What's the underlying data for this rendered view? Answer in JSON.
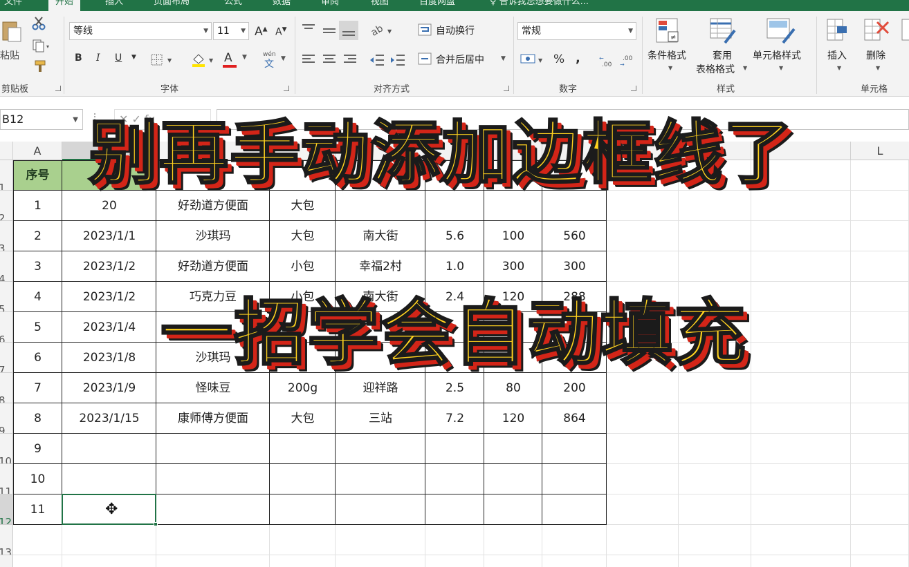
{
  "ribbon_tabs": [
    "文件",
    "开始",
    "插入",
    "页面布局",
    "公式",
    "数据",
    "审阅",
    "视图",
    "百度网盘",
    "告诉我您想要做什么..."
  ],
  "clipboard": {
    "paste_label": "粘贴",
    "group_label": "剪贴板"
  },
  "font": {
    "name": "等线",
    "size": "11",
    "bold": "B",
    "italic": "I",
    "underline": "U",
    "group_label": "字体",
    "grow": "A",
    "shrink": "A",
    "font_color_glyph": "A",
    "phonetic": "wén"
  },
  "alignment": {
    "wrap_label": "自动换行",
    "merge_label": "合并后居中",
    "group_label": "对齐方式"
  },
  "number": {
    "format": "常规",
    "percent": "%",
    "comma": ",",
    "group_label": "数字"
  },
  "styles": {
    "conditional_label": "条件格式",
    "table_format_label_1": "套用",
    "table_format_label_2": "表格格式",
    "cell_style_label": "单元格样式",
    "group_label": "样式"
  },
  "cells_group": {
    "insert_label": "插入",
    "delete_label": "删除",
    "group_label": "单元格"
  },
  "formula_bar": {
    "name_box": "B12",
    "fx_glyphs": "✕  ✓  fx"
  },
  "columns": [
    "A",
    "",
    "",
    "",
    "",
    "",
    "",
    "",
    "",
    "",
    "",
    "L"
  ],
  "rows": [
    "1",
    "2",
    "3",
    "4",
    "5",
    "6",
    "7",
    "8",
    "9",
    "10",
    "11",
    "12",
    "13"
  ],
  "table": {
    "headers": [
      "序号",
      "进"
    ],
    "rows": [
      [
        "1",
        "20",
        "好劲道方便面",
        "大包",
        "",
        "",
        "",
        ""
      ],
      [
        "2",
        "2023/1/1",
        "沙琪玛",
        "大包",
        "南大街",
        "5.6",
        "100",
        "560"
      ],
      [
        "3",
        "2023/1/2",
        "好劲道方便面",
        "小包",
        "幸福2村",
        "1.0",
        "300",
        "300"
      ],
      [
        "4",
        "2023/1/2",
        "巧克力豆",
        "小包",
        "南大街",
        "2.4",
        "120",
        "288"
      ],
      [
        "5",
        "2023/1/4",
        "",
        "",
        "",
        "",
        "",
        ""
      ],
      [
        "6",
        "2023/1/8",
        "沙琪玛",
        "",
        "",
        "",
        "",
        ""
      ],
      [
        "7",
        "2023/1/9",
        "怪味豆",
        "200g",
        "迎祥路",
        "2.5",
        "80",
        "200"
      ],
      [
        "8",
        "2023/1/15",
        "康师傅方便面",
        "大包",
        "三站",
        "7.2",
        "120",
        "864"
      ],
      [
        "9",
        "",
        "",
        "",
        "",
        "",
        "",
        ""
      ],
      [
        "10",
        "",
        "",
        "",
        "",
        "",
        "",
        ""
      ],
      [
        "11",
        "",
        "",
        "",
        "",
        "",
        "",
        ""
      ]
    ]
  },
  "overlay": {
    "line1": "别再手动添加边框线了",
    "line2": "一招学会自动填充"
  },
  "colors": {
    "excel_green": "#217346",
    "header_fill": "#a9d08e",
    "caption_yellow": "#ffd21f",
    "caption_red": "#d32518"
  }
}
